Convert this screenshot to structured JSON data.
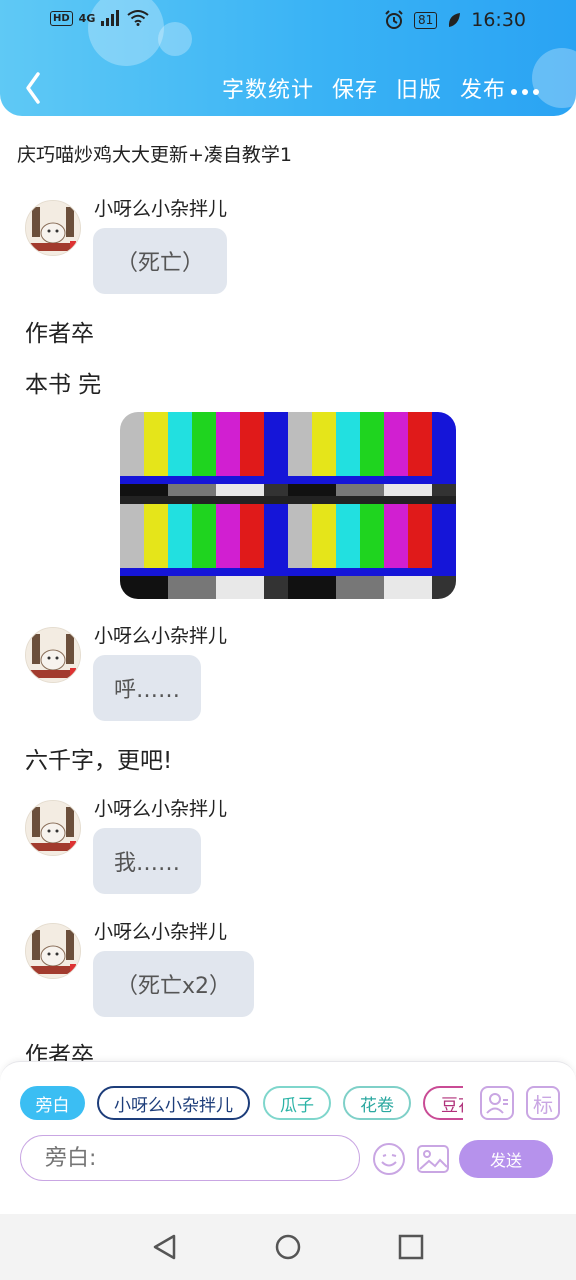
{
  "status_bar": {
    "network_hd": "HD",
    "network_gen": "4G",
    "battery": "81",
    "time": "16:30"
  },
  "toolbar": {
    "back_icon": "chevron-left-icon",
    "actions": [
      "字数统计",
      "保存",
      "旧版",
      "发布"
    ],
    "more_icon": "more-dots-icon"
  },
  "document": {
    "title": "庆巧喵炒鸡大大更新+凑自教学1"
  },
  "messages": [
    {
      "speaker": "小呀么小杂拌儿",
      "text": "（死亡）"
    },
    {
      "narration": "作者卒"
    },
    {
      "narration": "本书 完"
    },
    {
      "image": "color-bars-image"
    },
    {
      "speaker": "小呀么小杂拌儿",
      "text": "呼……"
    },
    {
      "narration": "六千字，更吧!"
    },
    {
      "speaker": "小呀么小杂拌儿",
      "text": "我……"
    },
    {
      "speaker": "小呀么小杂拌儿",
      "text": "（死亡x2）"
    },
    {
      "narration": "作者卒"
    }
  ],
  "composer": {
    "roles": [
      {
        "label": "旁白",
        "active": true,
        "color": "#3bbef3"
      },
      {
        "label": "小呀么小杂拌儿",
        "active": false,
        "color": "#1d3d7a"
      },
      {
        "label": "瓜子",
        "active": false,
        "color": "#2bb3a6"
      },
      {
        "label": "花卷",
        "active": false,
        "color": "#2ba8a0"
      },
      {
        "label": "豆花",
        "active": false,
        "color": "#b0307a"
      }
    ],
    "role_manage_label": "",
    "tag_label": "标",
    "input_placeholder": "旁白:",
    "send_label": "发送"
  },
  "colors": {
    "header_gradient_start": "#5fc9f5",
    "header_gradient_end": "#2aa3f3",
    "bubble_bg": "#e1e6ee",
    "send_bg": "#b692ec"
  }
}
